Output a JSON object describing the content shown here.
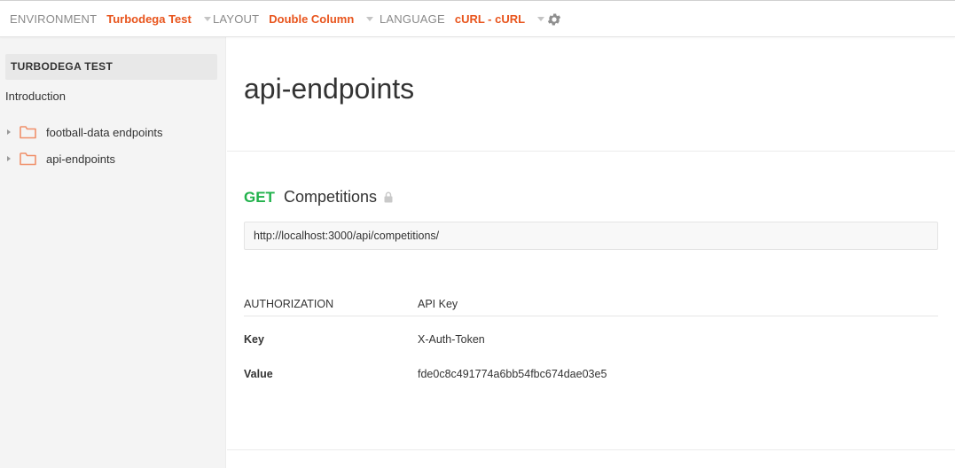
{
  "topbar": {
    "environment_label": "ENVIRONMENT",
    "environment_value": "Turbodega Test",
    "layout_label": "LAYOUT",
    "layout_value": "Double Column",
    "language_label": "LANGUAGE",
    "language_value": "cURL - cURL",
    "settings_icon": "gear-icon"
  },
  "sidebar": {
    "collection_title": "TURBODEGA TEST",
    "intro_label": "Introduction",
    "folders": [
      {
        "label": "football-data endpoints",
        "icon": "folder-icon"
      },
      {
        "label": "api-endpoints",
        "icon": "folder-icon"
      }
    ]
  },
  "main": {
    "folder_title": "api-endpoints",
    "request": {
      "method": "GET",
      "name": "Competitions",
      "url": "http://localhost:3000/api/competitions/"
    },
    "authorization": {
      "header_label": "AUTHORIZATION",
      "header_value": "API Key",
      "key_label": "Key",
      "key_value": "X-Auth-Token",
      "value_label": "Value",
      "value_value": "fde0c8c491774a6bb54fbc674dae03e5"
    }
  },
  "colors": {
    "accent": "#e8541c",
    "get_method": "#22b24c",
    "folder": "#f0906a"
  }
}
